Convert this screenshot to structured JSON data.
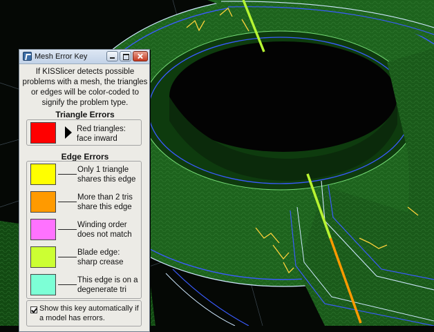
{
  "dialog": {
    "title": "Mesh Error Key",
    "intro": "If KISSlicer detects possible problems with a mesh, the triangles or edges will be color-coded to signify the problem type.",
    "triangle_section": {
      "title": "Triangle Errors",
      "item": {
        "color": "#ff0000",
        "text": "Red triangles: face inward"
      }
    },
    "edge_section": {
      "title": "Edge Errors",
      "items": [
        {
          "color": "#ffff00",
          "text": "Only 1 triangle shares this edge"
        },
        {
          "color": "#ff9a00",
          "text": "More than 2 tris share this edge"
        },
        {
          "color": "#ff72ff",
          "text": "Winding order does not match"
        },
        {
          "color": "#ccff33",
          "text": "Blade edge: sharp crease"
        },
        {
          "color": "#7dffd6",
          "text": "This edge is on a degenerate tri"
        }
      ]
    },
    "auto_show": {
      "checked": true,
      "label": "Show this key automatically if a model has errors."
    }
  },
  "icons": {
    "app": "app-icon",
    "minimize": "minimize-icon",
    "maximize": "maximize-icon",
    "close": "close-icon",
    "arrow": "arrow-right-icon"
  },
  "colors": {
    "mesh_green": "#1b5c1b",
    "mesh_edge": "#4fd84f",
    "contour_blue": "#3a5bff",
    "contour_light": "#cfe8ff",
    "error_yellow": "#ffd23a"
  }
}
